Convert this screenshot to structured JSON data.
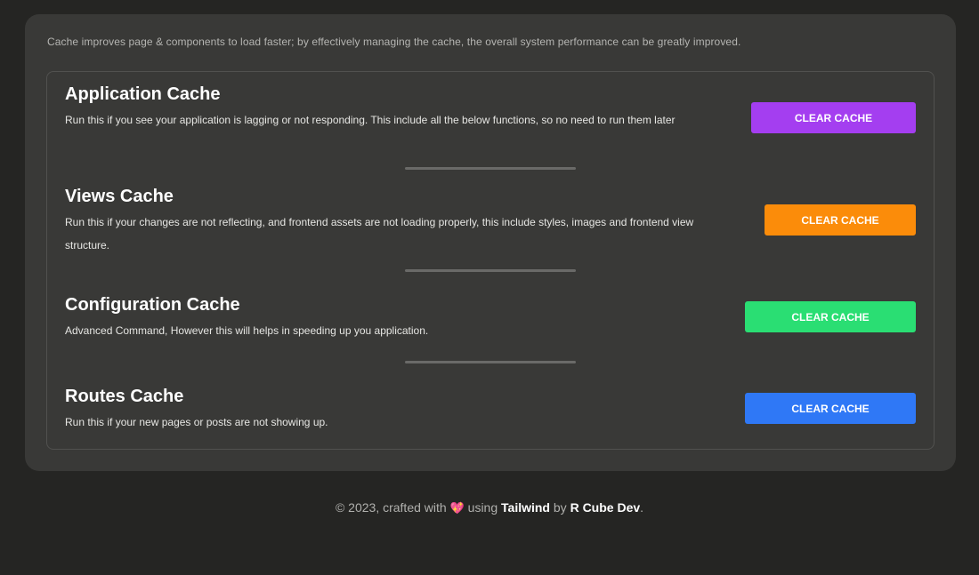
{
  "intro": "Cache improves page & components to load faster; by effectively managing the cache, the overall system performance can be greatly improved.",
  "sections": [
    {
      "title": "Application Cache",
      "description": "Run this if you see your application is lagging or not responding. This include all the below functions, so no need to run them later",
      "button_label": "Clear Cache",
      "button_color": "#a43ef0"
    },
    {
      "title": "Views Cache",
      "description": "Run this if your changes are not reflecting, and frontend assets are not loading properly, this include styles, images and frontend view structure.",
      "button_label": "Clear Cache",
      "button_color": "#fb8c0a"
    },
    {
      "title": "Configuration Cache",
      "description": "Advanced Command, However this will helps in speeding up you application.",
      "button_label": "Clear Cache",
      "button_color": "#2ade73"
    },
    {
      "title": "Routes Cache",
      "description": "Run this if your new pages or posts are not showing up.",
      "button_label": "Clear Cache",
      "button_color": "#2f78f6"
    }
  ],
  "footer": {
    "prefix": "© 2023, crafted with",
    "heart_icon": "heart-icon",
    "using": "using",
    "framework": "Tailwind",
    "by": "by",
    "author": "R Cube Dev",
    "suffix": "."
  }
}
